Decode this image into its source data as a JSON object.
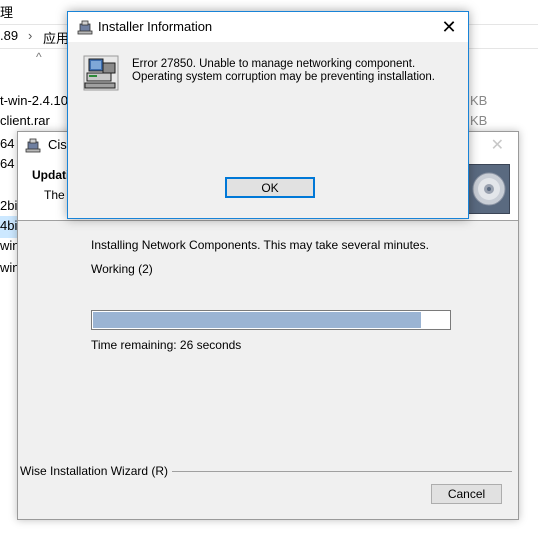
{
  "explorer": {
    "top_left_char": "理",
    "breadcrumb_version": ".89",
    "breadcrumb_separator": "›",
    "breadcrumb_folder": "应用",
    "sort_arrow": "^",
    "files": [
      {
        "name": "t-win-2.4.10",
        "size": "KB"
      },
      {
        "name": "client.rar",
        "size": "KB"
      },
      {
        "name": "64",
        "size": ""
      },
      {
        "name": "64",
        "size": ""
      },
      {
        "name": "2bi",
        "size": ""
      },
      {
        "name": "4bi",
        "size": ""
      },
      {
        "name": "winx",
        "size": ""
      },
      {
        "name": "winx",
        "size": ""
      }
    ]
  },
  "wizard": {
    "title": "Cisc",
    "close_glyph": "✕",
    "header_title": "Updatin",
    "header_subtitle": "The",
    "status_text": "Installing Network Components.  This may take several minutes.",
    "working_text": "Working  (2)",
    "progress_percent": 92,
    "time_remaining": "Time remaining: 26 seconds",
    "brand": "Wise Installation Wizard (R)",
    "cancel_label": "Cancel",
    "cd_icon": "cd-disc-icon"
  },
  "dialog": {
    "title": "Installer Information",
    "close_glyph": "✕",
    "message_line1": "Error 27850. Unable to manage networking component.",
    "message_line2": "Operating system corruption may be preventing installation.",
    "ok_label": "OK",
    "icon": "installer-computer-icon"
  },
  "colors": {
    "dialog_border": "#1883d7",
    "progress_fill": "#9bb4d3",
    "button_focus": "#0078d7",
    "selection": "#cce8ff"
  }
}
